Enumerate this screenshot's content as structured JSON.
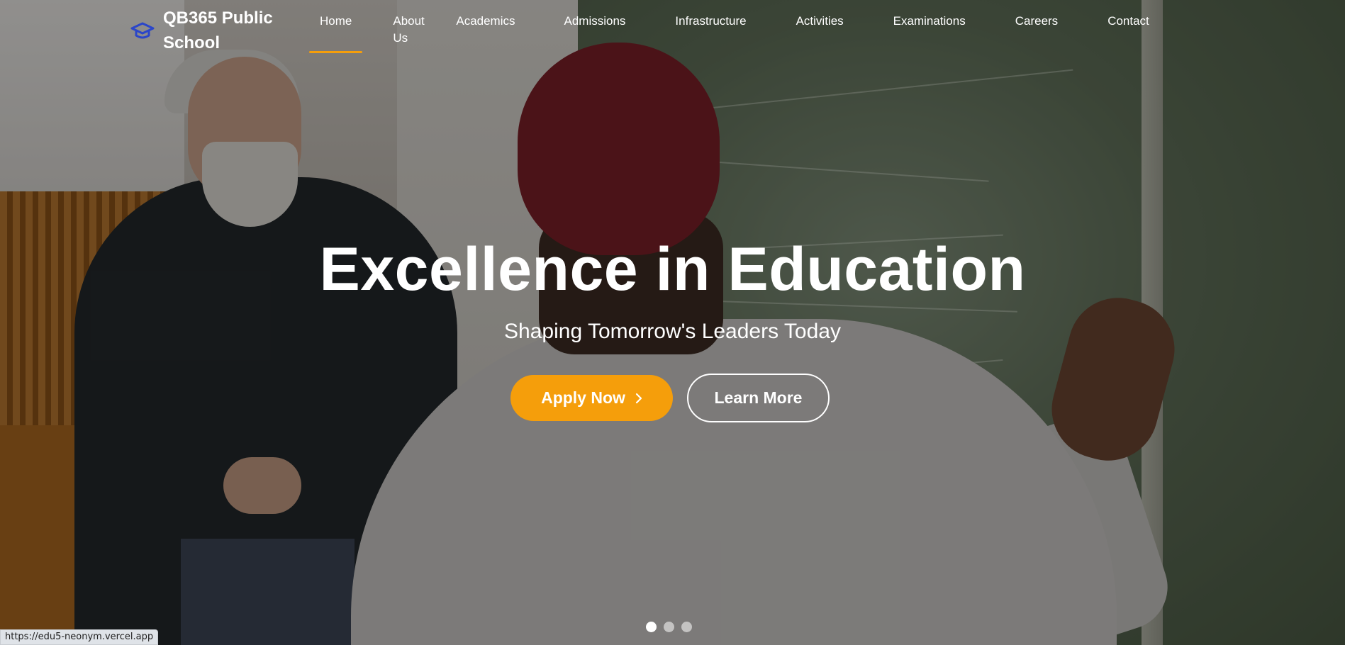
{
  "brand": {
    "name": "QB365 Public School",
    "icon": "graduation-cap-icon",
    "icon_color": "#1e3a8a"
  },
  "nav": {
    "items": [
      {
        "label": "Home",
        "active": true
      },
      {
        "label": "About Us"
      },
      {
        "label": "Academics"
      },
      {
        "label": "Admissions"
      },
      {
        "label": "Infrastructure"
      },
      {
        "label": "Activities"
      },
      {
        "label": "Examinations"
      },
      {
        "label": "Careers"
      },
      {
        "label": "Contact"
      }
    ],
    "active_indicator_color": "#f59e0b"
  },
  "hero": {
    "title": "Excellence in Education",
    "subtitle": "Shaping Tomorrow's Leaders Today",
    "primary_button": {
      "label": "Apply Now",
      "icon": "chevron-right-icon",
      "color": "#f59e0b"
    },
    "secondary_button": {
      "label": "Learn More"
    },
    "slides": {
      "count": 3,
      "active_index": 0
    }
  },
  "status_bar": {
    "url": "https://edu5-neonym.vercel.app"
  }
}
